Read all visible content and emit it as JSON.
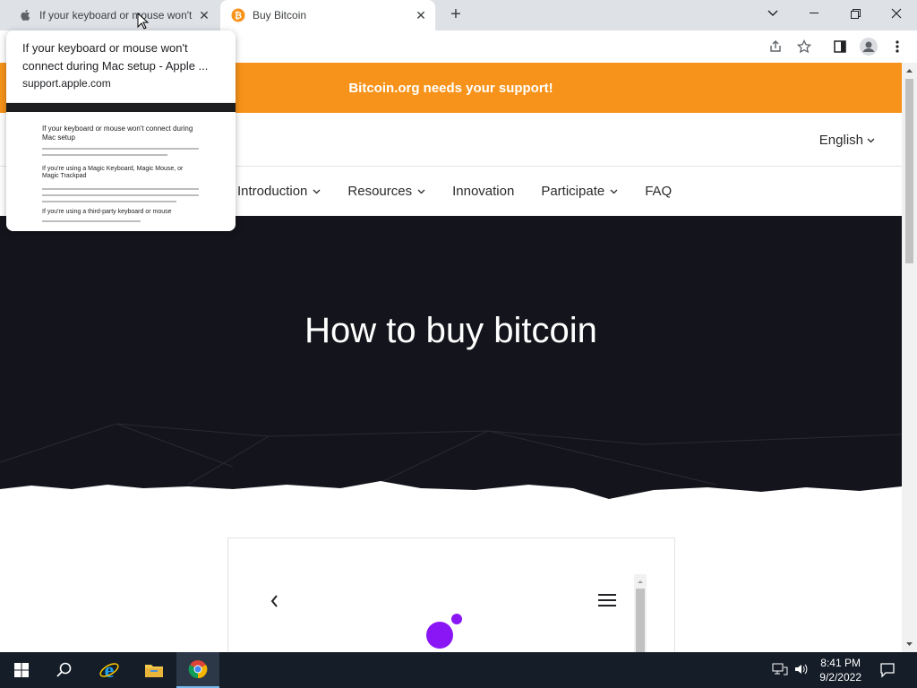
{
  "tabs": [
    {
      "title": "If your keyboard or mouse won't",
      "favicon": "apple-icon",
      "active": false
    },
    {
      "title": "Buy Bitcoin",
      "favicon": "bitcoin-icon",
      "active": true
    }
  ],
  "hover_card": {
    "title": "If your keyboard or mouse won't connect during Mac setup - Apple ...",
    "domain": "support.apple.com",
    "thumbnail": {
      "heading": "If your keyboard or mouse won't connect during Mac setup",
      "section1": "If you're using a Magic Keyboard, Magic Mouse, or Magic Trackpad",
      "section2": "If you're using a third-party keyboard or mouse"
    }
  },
  "page": {
    "banner": "Bitcoin.org needs your support!",
    "language": "English",
    "nav": [
      {
        "label": "Introduction",
        "dropdown": true
      },
      {
        "label": "Resources",
        "dropdown": true
      },
      {
        "label": "Innovation",
        "dropdown": false
      },
      {
        "label": "Participate",
        "dropdown": true
      },
      {
        "label": "FAQ",
        "dropdown": false
      }
    ],
    "hero_title": "How to buy bitcoin"
  },
  "taskbar": {
    "time": "8:41 PM",
    "date": "9/2/2022"
  },
  "colors": {
    "banner": "#f7931a",
    "hero_bg": "#14141c",
    "accent_purple": "#8a16f5"
  }
}
